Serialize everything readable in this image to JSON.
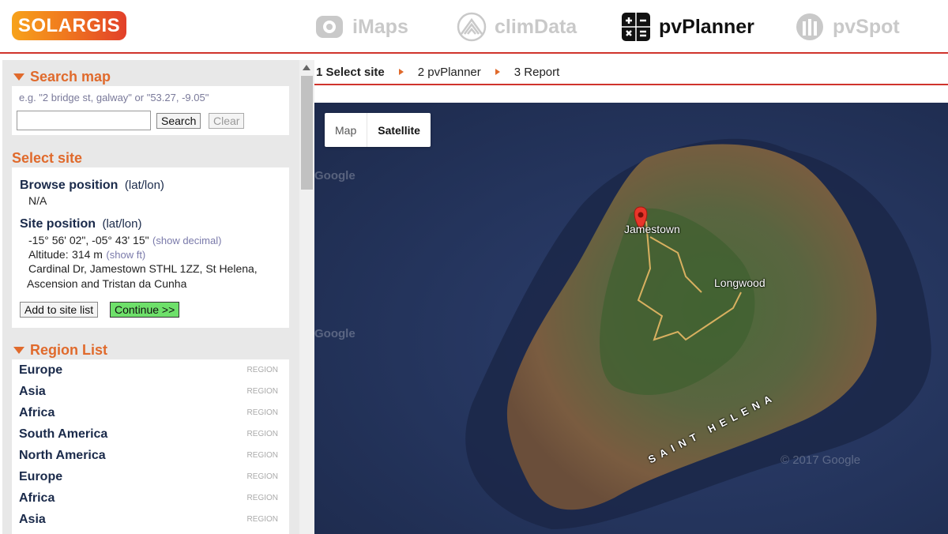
{
  "header": {
    "logo": "SOLARGIS",
    "apps": [
      {
        "label": "iMaps"
      },
      {
        "label": "climData"
      },
      {
        "label": "pvPlanner"
      },
      {
        "label": "pvSpot"
      }
    ]
  },
  "search": {
    "title": "Search map",
    "hint": "e.g. \"2 bridge st, galway\" or \"53.27, -9.05\"",
    "value": "",
    "search_button": "Search",
    "clear_button": "Clear"
  },
  "site": {
    "title": "Select site",
    "browse_label": "Browse position",
    "browse_unit": "(lat/lon)",
    "browse_value": "N/A",
    "site_label": "Site position",
    "site_unit": "(lat/lon)",
    "coords": "-15° 56' 02\", -05° 43' 15\"",
    "show_decimal": "(show decimal)",
    "altitude_label": "Altitude:",
    "altitude_value": "314 m",
    "show_ft": "(show ft)",
    "address_line1": "Cardinal Dr, Jamestown STHL 1ZZ, St Helena,",
    "address_line2": "Ascension and Tristan da Cunha",
    "add_button": "Add to site list",
    "continue_button": "Continue >>"
  },
  "regions": {
    "title": "Region List",
    "tag": "REGION",
    "items": [
      "Europe",
      "Asia",
      "Africa",
      "South America",
      "North America",
      "Europe",
      "Africa",
      "Asia"
    ]
  },
  "steps": [
    {
      "label": "1 Select site"
    },
    {
      "label": "2 pvPlanner"
    },
    {
      "label": "3 Report"
    }
  ],
  "map": {
    "type_map": "Map",
    "type_satellite": "Satellite",
    "labels": {
      "jamestown": "Jamestown",
      "longwood": "Longwood",
      "island": "SAINT HELENA"
    },
    "watermark": "Google",
    "copyright": "© 2017 Google"
  }
}
